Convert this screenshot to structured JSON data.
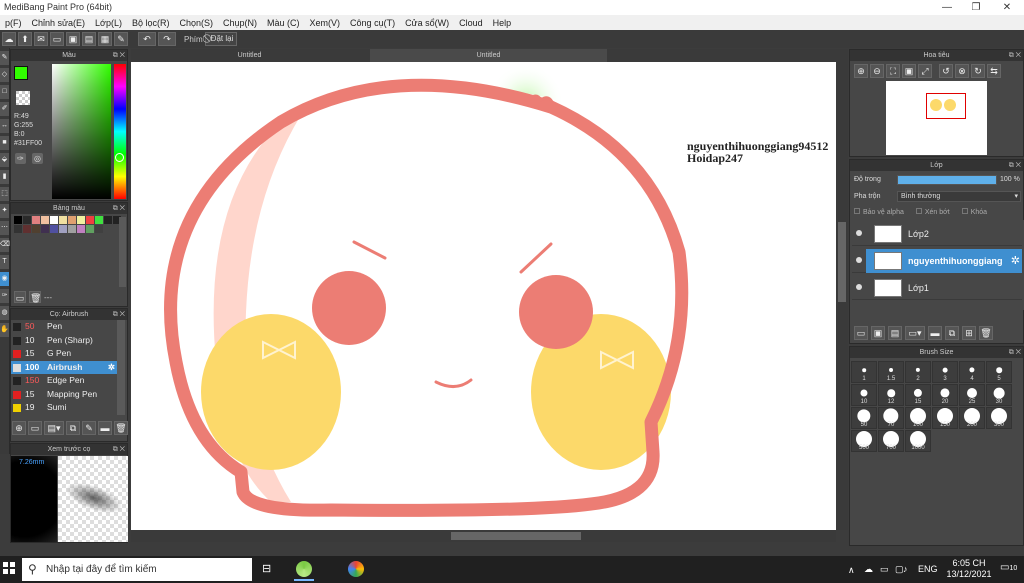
{
  "window": {
    "title": "MediBang Paint Pro (64bit)"
  },
  "menu": [
    "p(F)",
    "Chỉnh sửa(E)",
    "Lớp(L)",
    "Bộ lọc(R)",
    "Chọn(S)",
    "Chụp(N)",
    "Màu (C)",
    "Xem(V)",
    "Công cụ(T)",
    "Cửa sổ(W)",
    "Cloud",
    "Help"
  ],
  "toolbar": {
    "phim_label": "Phím",
    "reset_label": "Đặt lại"
  },
  "tabs": [
    "Untitled",
    "Untitled"
  ],
  "color_panel": {
    "title": "Màu",
    "rgb_r": "R:49",
    "rgb_g": "G:255",
    "rgb_b": "B:0",
    "hex": "#31FF00",
    "primary_color": "#31ff00"
  },
  "palette_panel": {
    "title": "Bảng màu",
    "menu_label": "---"
  },
  "brush_panel": {
    "title": "Cọ: Airbrush",
    "items": [
      {
        "size": "50",
        "name": "Pen",
        "color": "#222222",
        "size_color": "#ff5a5a"
      },
      {
        "size": "10",
        "name": "Pen (Sharp)",
        "color": "#222222",
        "size_color": "#eeeeee"
      },
      {
        "size": "15",
        "name": "G Pen",
        "color": "#e02020",
        "size_color": "#eeeeee"
      },
      {
        "size": "100",
        "name": "Airbrush",
        "color": "#dddddd",
        "size_color": "#ffffff"
      },
      {
        "size": "150",
        "name": "Edge Pen",
        "color": "#222222",
        "size_color": "#ff5a5a"
      },
      {
        "size": "15",
        "name": "Mapping Pen",
        "color": "#e02020",
        "size_color": "#eeeeee"
      },
      {
        "size": "19",
        "name": "Sumi",
        "color": "#f0d000",
        "size_color": "#eeeeee"
      }
    ]
  },
  "preview_panel": {
    "title": "Xem trước cọ",
    "size_label": "7.26mm"
  },
  "navigator": {
    "title": "Hoa tiêu"
  },
  "layer_panel": {
    "title": "Lớp",
    "opacity_label": "Độ trong",
    "opacity_value": "100 %",
    "opacity_fraction": 1.0,
    "blend_label": "Pha trộn",
    "blend_value": "Bình thường",
    "protect_alpha": "Bảo vệ alpha",
    "clipping": "Xén bớt",
    "lock": "Khóa",
    "layers": [
      {
        "name": "Lớp2",
        "selected": false
      },
      {
        "name": "nguyenthihuonggiang",
        "selected": true
      },
      {
        "name": "Lớp1",
        "selected": false
      }
    ]
  },
  "brush_size_panel": {
    "title": "Brush Size",
    "sizes": [
      "1",
      "1.5",
      "2",
      "3",
      "4",
      "5",
      "10",
      "12",
      "15",
      "20",
      "25",
      "30",
      "50",
      "70",
      "100",
      "150",
      "200",
      "300",
      "500",
      "700",
      "1000"
    ]
  },
  "canvas": {
    "watermark_line1": "nguyenthihuonggiang94512",
    "watermark_line2": "Hoidap247"
  },
  "taskbar": {
    "search_placeholder": "Nhập tại đây để tìm kiếm",
    "lang": "ENG",
    "time": "6:05 CH",
    "date": "13/12/2021",
    "notifications": "10"
  }
}
